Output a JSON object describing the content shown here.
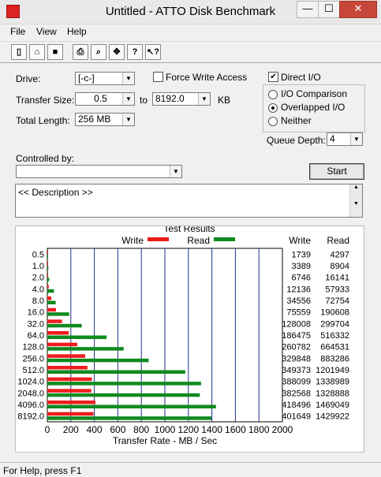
{
  "window": {
    "title": "Untitled - ATTO Disk Benchmark",
    "min": "—",
    "max": "☐",
    "close": "✕"
  },
  "menu": [
    "File",
    "View",
    "Help"
  ],
  "toolbar": [
    {
      "name": "new-icon",
      "glyph": "▯"
    },
    {
      "name": "open-icon",
      "glyph": "⌂"
    },
    {
      "name": "save-icon",
      "glyph": "■"
    },
    {
      "name": "print-icon",
      "glyph": "⎙"
    },
    {
      "name": "print-preview-icon",
      "glyph": "⌕"
    },
    {
      "name": "move-icon",
      "glyph": "✥"
    },
    {
      "name": "help-icon",
      "glyph": "?"
    },
    {
      "name": "context-help-icon",
      "glyph": "↖?"
    }
  ],
  "form": {
    "drive_label": "Drive:",
    "drive_value": "[-c-]",
    "force_write_label": "Force Write Access",
    "direct_io_label": "Direct I/O",
    "direct_io_checked": "✔",
    "transfer_size_label": "Transfer Size:",
    "transfer_from": "0.5",
    "to_label": "to",
    "transfer_to": "8192.0",
    "kb_label": "KB",
    "total_length_label": "Total Length:",
    "total_length": "256 MB",
    "io_comparison": "I/O Comparison",
    "overlapped_io": "Overlapped I/O",
    "neither": "Neither",
    "queue_depth_label": "Queue Depth:",
    "queue_depth": "4",
    "controlled_by_label": "Controlled by:",
    "controlled_by_value": "",
    "start_label": "Start",
    "description": "<< Description >>"
  },
  "chart_data": {
    "type": "bar",
    "title": "Test Results",
    "xlabel": "Transfer Rate - MB / Sec",
    "xlim": [
      0,
      2000
    ],
    "xticks": [
      "0",
      "200",
      "400",
      "600",
      "800",
      "1000",
      "1200",
      "1400",
      "1600",
      "1800",
      "2000"
    ],
    "categories": [
      "0.5",
      "1.0",
      "2.0",
      "4.0",
      "8.0",
      "16.0",
      "32.0",
      "64.0",
      "128.0",
      "256.0",
      "512.0",
      "1024.0",
      "2048.0",
      "4096.0",
      "8192.0"
    ],
    "series": [
      {
        "name": "Write",
        "color": "#ee1c1c",
        "values": [
          1.7,
          3.3,
          6.6,
          11.9,
          33.7,
          73.8,
          125.0,
          182.1,
          254.7,
          322.1,
          341.2,
          378.9,
          373.9,
          408.7,
          392.2
        ],
        "table": [
          "1739",
          "3389",
          "6746",
          "12136",
          "34556",
          "75559",
          "128008",
          "186475",
          "260782",
          "329848",
          "349373",
          "388099",
          "382568",
          "418496",
          "401649"
        ]
      },
      {
        "name": "Read",
        "color": "#0f8a1f",
        "values": [
          4.2,
          8.7,
          15.8,
          56.6,
          71.0,
          186.1,
          292.7,
          504.2,
          649.0,
          862.0,
          1173.8,
          1307.9,
          1297.7,
          1434.6,
          1396.4
        ],
        "table": [
          "4297",
          "8904",
          "16141",
          "57933",
          "72754",
          "190608",
          "299704",
          "516332",
          "664531",
          "883286",
          "1201949",
          "1338989",
          "1328888",
          "1469049",
          "1429922"
        ]
      }
    ],
    "legend": "top"
  },
  "status": "For Help, press F1"
}
